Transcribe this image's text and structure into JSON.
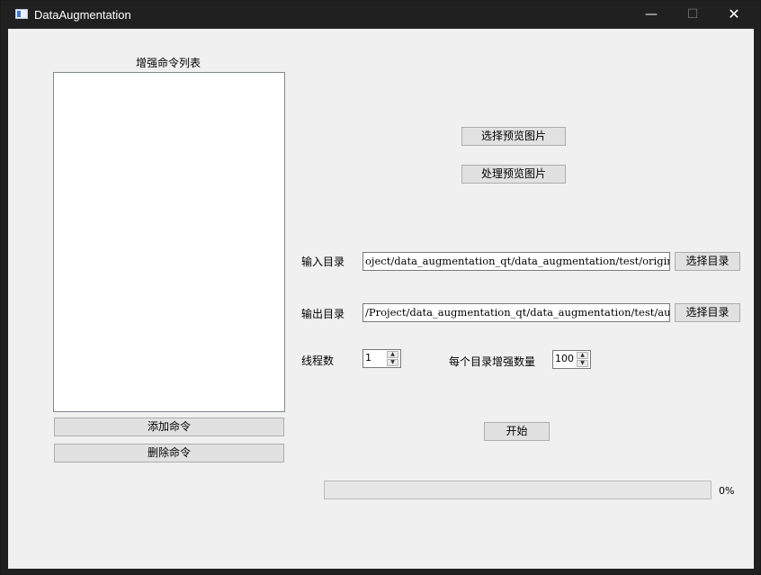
{
  "window": {
    "title": "DataAugmentation",
    "controls": {
      "minimize": "—",
      "maximize": "☐",
      "close": "✕"
    }
  },
  "left_panel": {
    "list_title": "增强命令列表",
    "items": [],
    "add_button": "添加命令",
    "delete_button": "删除命令"
  },
  "preview": {
    "select_button": "选择预览图片",
    "process_button": "处理预览图片"
  },
  "input_dir": {
    "label": "输入目录",
    "value": "oject/data_augmentation_qt/data_augmentation/test/origin",
    "browse_button": "选择目录"
  },
  "output_dir": {
    "label": "输出目录",
    "value": "/Project/data_augmentation_qt/data_augmentation/test/aug",
    "browse_button": "选择目录"
  },
  "threads": {
    "label": "线程数",
    "value": "1"
  },
  "per_dir": {
    "label": "每个目录增强数量",
    "value": "100"
  },
  "start_button": "开始",
  "progress": {
    "value": 0,
    "text": "0%",
    "fill_color": "#06b025"
  }
}
